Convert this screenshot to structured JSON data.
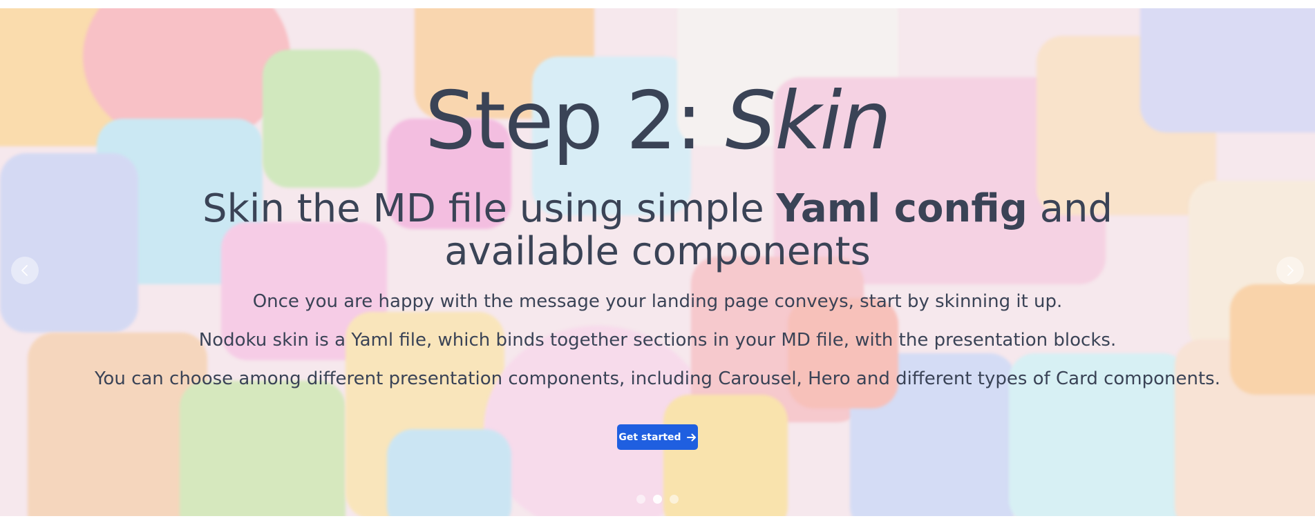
{
  "slide": {
    "title_prefix": "Step 2: ",
    "title_emphasis": "Skin",
    "subtitle_before": "Skin the MD file using simple ",
    "subtitle_bold": "Yaml config",
    "subtitle_after": " and available components",
    "paragraphs": [
      "Once you are happy with the message your landing page conveys, start by skinning it up.",
      "Nodoku skin is a Yaml file, which binds together sections in your MD file, with the presentation blocks.",
      "You can choose among different presentation components, including Carousel, Hero and different types of Card components."
    ],
    "cta_label": "Get started"
  },
  "carousel": {
    "slide_count": 3,
    "active_index": 1
  },
  "icons": {
    "prev": "chevron-left-icon",
    "next": "chevron-right-icon",
    "cta": "arrow-right-icon"
  },
  "colors": {
    "text": "#3a4356",
    "cta_background": "#1f5fe0",
    "cta_text": "#ffffff"
  }
}
